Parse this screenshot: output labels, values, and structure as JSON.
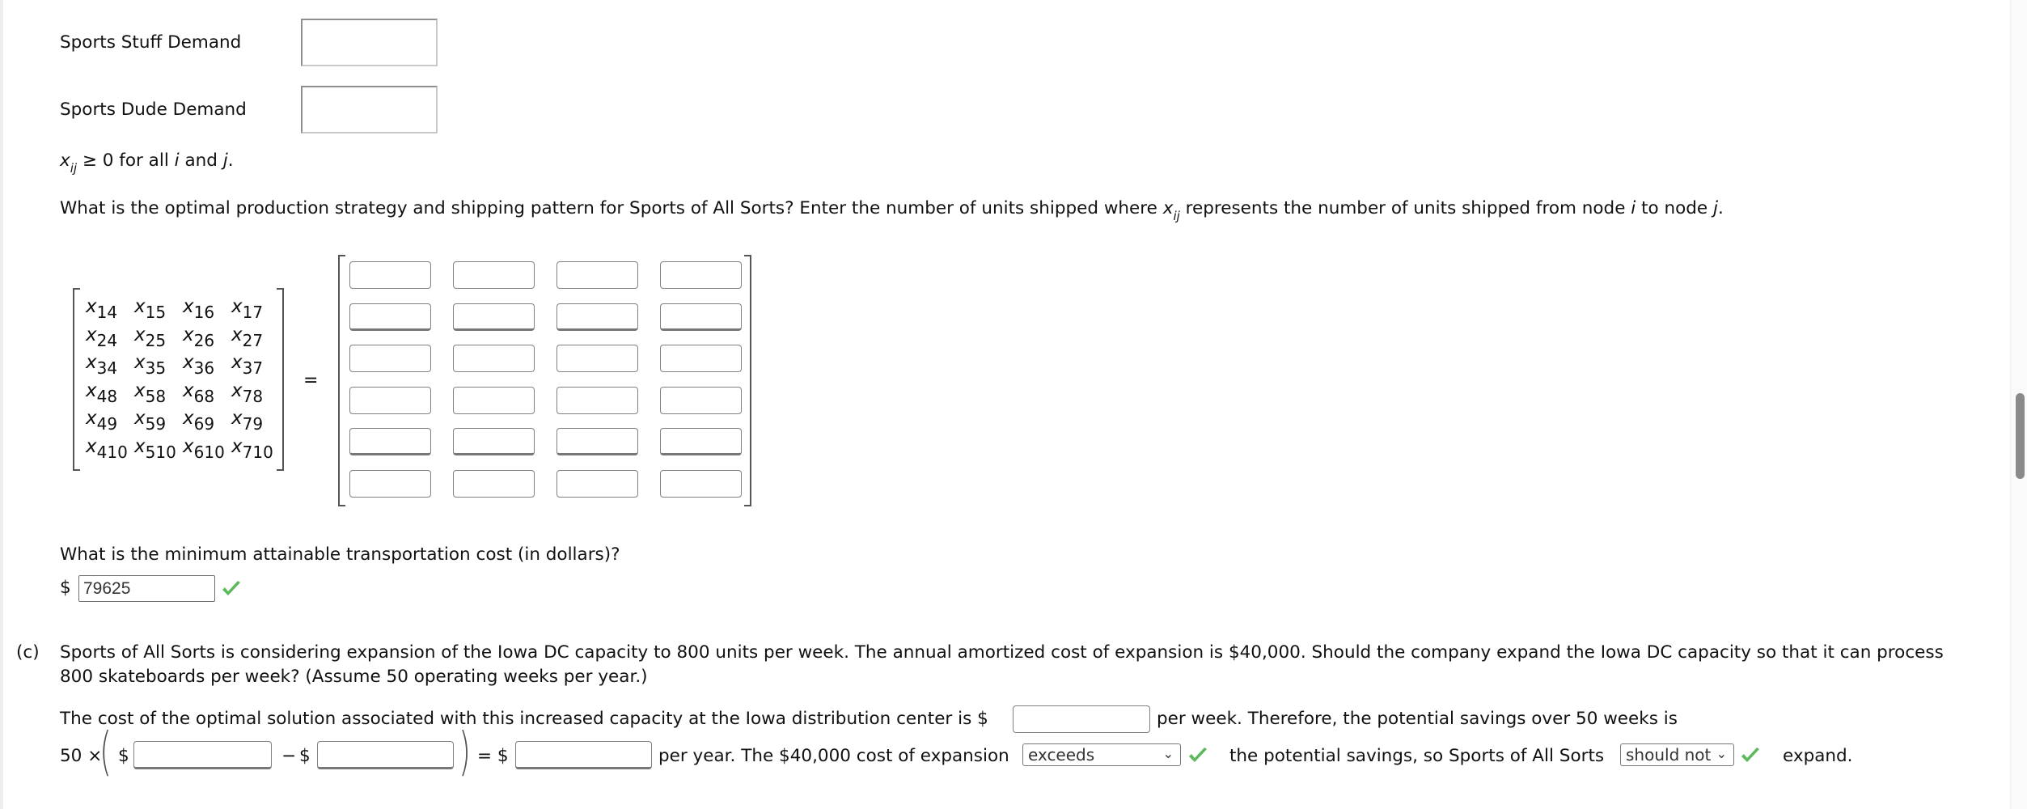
{
  "demand_rows": [
    {
      "label": "Sports Stuff Demand",
      "value": ""
    },
    {
      "label": "Sports Dude Demand",
      "value": ""
    }
  ],
  "nonneg": {
    "var": "x",
    "sub": "ij",
    "text": " ≥ 0 for all ",
    "i": "i",
    "and": " and ",
    "j": "j",
    "end": "."
  },
  "question1": {
    "before": "What is the optimal production strategy and shipping pattern for Sports of All Sorts? Enter the number of units shipped where ",
    "var": "x",
    "sub": "ij",
    "mid": " represents the number of units shipped from node ",
    "i": "i",
    "to": " to node ",
    "j": "j",
    "end": "."
  },
  "matrix": {
    "var": "x",
    "subs": [
      [
        "14",
        "15",
        "16",
        "17"
      ],
      [
        "24",
        "25",
        "26",
        "27"
      ],
      [
        "34",
        "35",
        "36",
        "37"
      ],
      [
        "48",
        "58",
        "68",
        "78"
      ],
      [
        "49",
        "59",
        "69",
        "79"
      ],
      [
        "410",
        "510",
        "610",
        "710"
      ]
    ],
    "equals": "=",
    "answers": [
      [
        "",
        "",
        "",
        ""
      ],
      [
        "",
        "",
        "",
        ""
      ],
      [
        "",
        "",
        "",
        ""
      ],
      [
        "",
        "",
        "",
        ""
      ],
      [
        "",
        "",
        "",
        ""
      ],
      [
        "",
        "",
        "",
        ""
      ]
    ]
  },
  "min_cost": {
    "question": "What is the minimum attainable transportation cost (in dollars)?",
    "currency": "$",
    "value": "79625",
    "status": "correct"
  },
  "part_c": {
    "label": "(c)",
    "line1": "Sports of All Sorts is considering expansion of the Iowa DC capacity to 800 units per week. The annual amortized cost of expansion is $40,000. Should the company expand the Iowa DC capacity so that it can process",
    "line2": "800 skateboards per week? (Assume 50 operating weeks per year.)",
    "cost_text_before": "The cost of the optimal solution associated with this increased capacity at the Iowa distribution center is $",
    "cost_value": "",
    "cost_text_after": "per week. Therefore, the potential savings over 50 weeks is",
    "calc_prefix": "50 ×",
    "dollar": "$",
    "minus": "−",
    "equals": "= $",
    "calc_value1": "",
    "calc_value2": "",
    "calc_result": "",
    "per_year_text": "per year. The $40,000 cost of expansion",
    "compare_select": {
      "value": "exceeds",
      "status": "correct"
    },
    "middle_text": "the potential savings, so Sports of All Sorts",
    "should_select": {
      "value": "should not",
      "status": "correct"
    },
    "end_text": "expand."
  },
  "colors": {
    "check_green": "#5cb85c"
  }
}
